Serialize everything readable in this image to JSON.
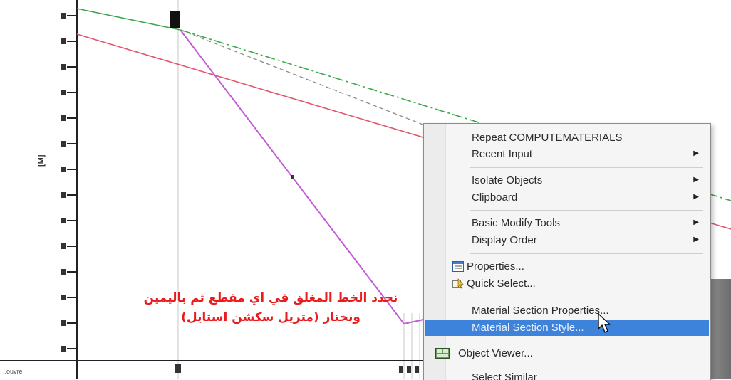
{
  "profile": {
    "axis_unit_label": "[M]",
    "corner_label": "..ouvre"
  },
  "annotation": {
    "line1": "نحدد الخط المغلق في اي مقطع ثم باليمين",
    "line2": "ونختار (متريل سكشن استايل)",
    "color": "#e81c1c"
  },
  "context_menu": {
    "repeat_command": "Repeat COMPUTEMATERIALS",
    "recent_input": "Recent Input",
    "isolate_objects": "Isolate Objects",
    "clipboard": "Clipboard",
    "basic_modify_tools": "Basic Modify Tools",
    "display_order": "Display Order",
    "properties": "Properties...",
    "quick_select": "Quick Select...",
    "material_section_properties": "Material Section Properties...",
    "material_section_style": "Material Section Style...",
    "object_viewer": "Object Viewer...",
    "select_similar": "Select Similar",
    "highlight_color": "#3d82db",
    "submenu_arrow": "▶"
  },
  "colors": {
    "green_line": "#3aa84a",
    "red_line": "#e0566a",
    "magenta_line": "#c25bd6",
    "grid": "#bdbdbd"
  }
}
